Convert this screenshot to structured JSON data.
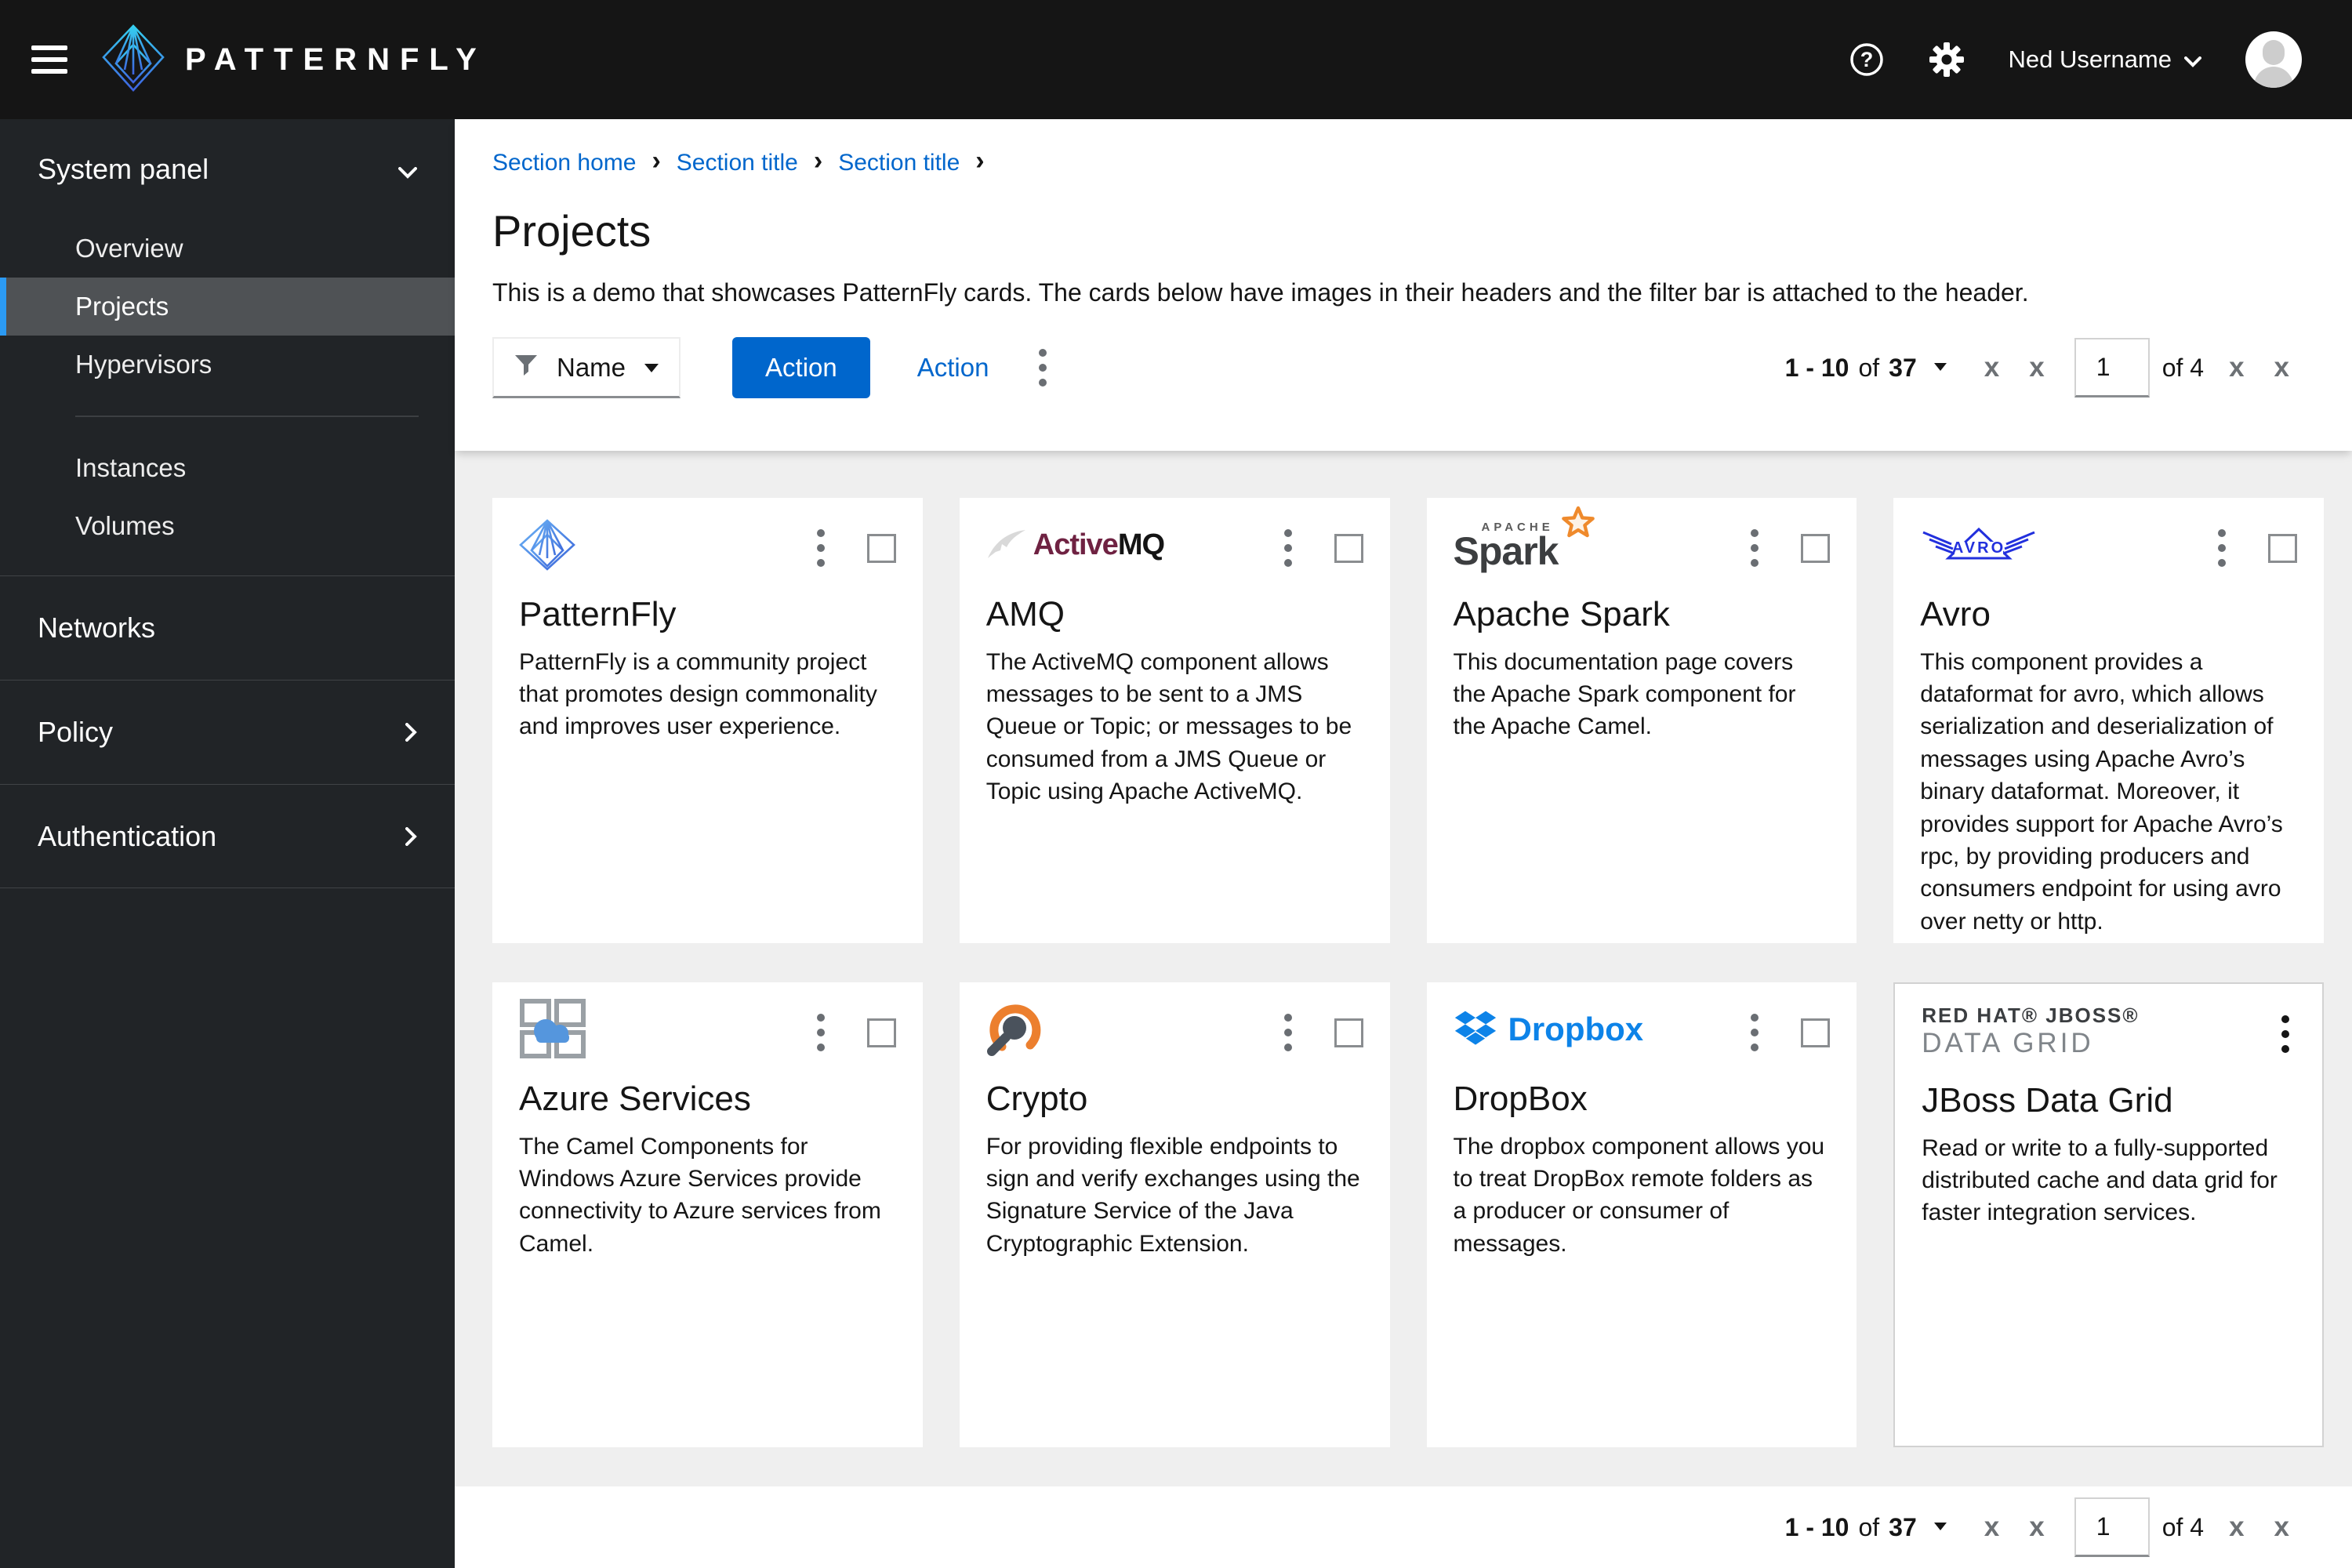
{
  "masthead": {
    "brand": "PATTERNFLY",
    "username": "Ned Username",
    "help_glyph": "?"
  },
  "sidebar": {
    "groups": [
      {
        "label": "System panel",
        "items": [
          "Overview",
          "Projects",
          "Hypervisors",
          "Instances",
          "Volumes"
        ]
      },
      {
        "label": "Networks"
      },
      {
        "label": "Policy"
      },
      {
        "label": "Authentication"
      }
    ]
  },
  "breadcrumb": {
    "items": [
      "Section home",
      "Section title",
      "Section title"
    ]
  },
  "page": {
    "title": "Projects",
    "description": "This is a demo that showcases PatternFly cards. The cards below have images in their headers and the filter bar is attached to the header."
  },
  "toolbar": {
    "filter_label": "Name",
    "primary_action": "Action",
    "secondary_action": "Action"
  },
  "pagination": {
    "range": "1 - 10",
    "of_label": "of",
    "total": "37",
    "current_page": "1",
    "page_count_label": "of 4",
    "nav_first": "x",
    "nav_prev": "x",
    "nav_next": "x",
    "nav_last": "x"
  },
  "cards": [
    {
      "title": "PatternFly",
      "description": "PatternFly is a community project that promotes design commonality and improves user experience."
    },
    {
      "title": "AMQ",
      "logo_active": "Active",
      "logo_mq": "MQ",
      "description": "The ActiveMQ component allows messages to be sent to a JMS Queue or Topic; or messages to be consumed from a JMS Queue or Topic using Apache ActiveMQ."
    },
    {
      "title": "Apache Spark",
      "logo_apache": "APACHE",
      "logo_spark": "Spark",
      "description": "This documentation page covers the Apache Spark component for the Apache Camel."
    },
    {
      "title": "Avro",
      "logo_avro": "AVRO",
      "description": "This component provides a dataformat for avro, which allows serialization and deserialization of messages using Apache Avro’s binary dataformat. Moreover, it provides support for Apache Avro’s rpc, by providing producers and consumers endpoint for using avro over netty or http."
    },
    {
      "title": "Azure Services",
      "description": "The Camel Components for Windows Azure Services provide connectivity to Azure services from Camel."
    },
    {
      "title": "Crypto",
      "description": "For providing flexible endpoints to sign and verify exchanges using the Signature Service of the Java Cryptographic Extension."
    },
    {
      "title": "DropBox",
      "logo_dropbox": "Dropbox",
      "description": "The dropbox component allows you to treat DropBox remote folders as a producer or consumer of messages."
    },
    {
      "title": "JBoss Data Grid",
      "logo_line1": "RED HAT® JBOSS®",
      "logo_line2": "DATA GRID",
      "description": "Read or write to a fully-supported distributed cache and data grid for faster integration services."
    }
  ],
  "colors": {
    "accent_blue": "#0066cc",
    "masthead_bg": "#151515",
    "sidebar_bg": "#212427",
    "selected_item_bar": "#2b9af3",
    "content_bg": "#efefef"
  }
}
